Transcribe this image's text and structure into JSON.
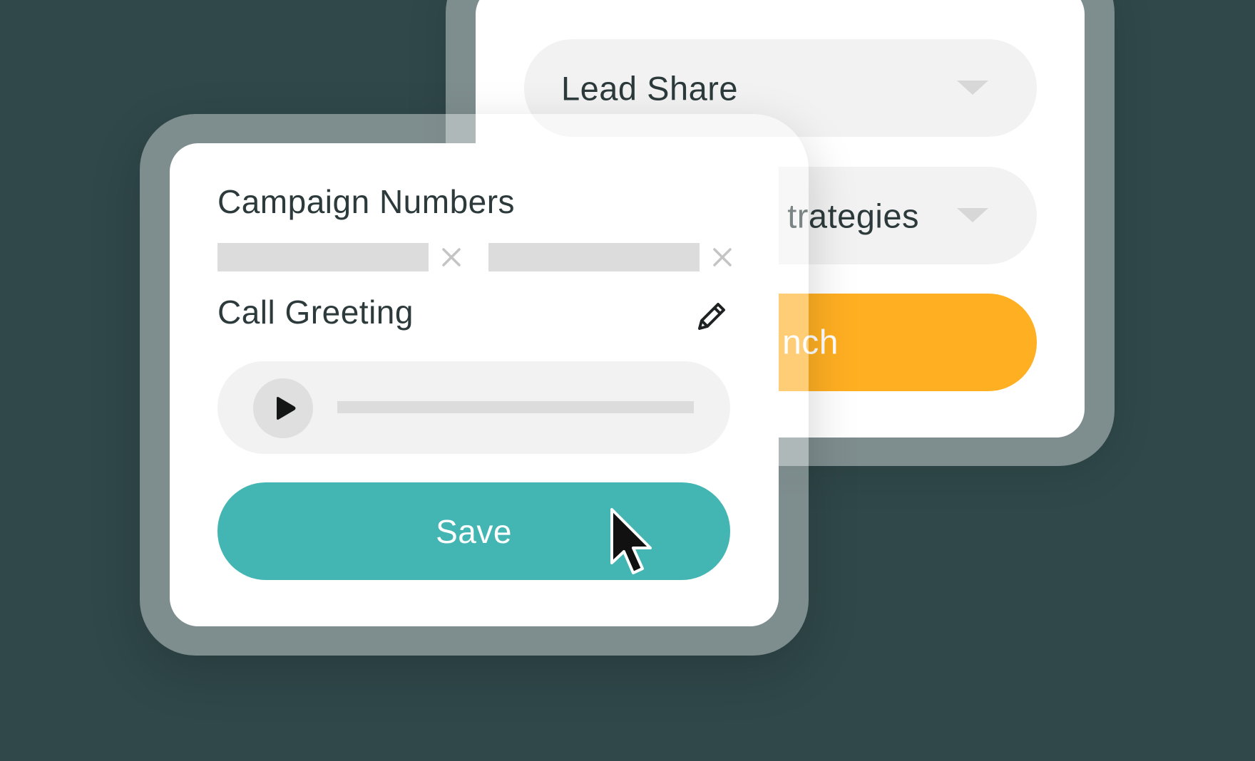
{
  "back_card": {
    "lead_share_select": {
      "label": "Lead Share"
    },
    "strategies_select": {
      "label": "trategies"
    },
    "launch_button": {
      "label": "nch"
    }
  },
  "front_card": {
    "campaign_numbers": {
      "title": "Campaign Numbers",
      "chips": [
        {
          "value": "",
          "remove_icon": "close-icon"
        },
        {
          "value": "",
          "remove_icon": "close-icon"
        }
      ]
    },
    "call_greeting": {
      "title": "Call Greeting",
      "edit_icon": "pencil-icon",
      "player": {
        "play_icon": "play-icon"
      }
    },
    "save_button": {
      "label": "Save"
    }
  },
  "icons": {
    "caret": "chevron-down-icon",
    "cursor": "mouse-pointer-icon"
  },
  "colors": {
    "background": "#30484A",
    "card": "#FFFFFF",
    "pill": "#F2F2F2",
    "placeholder": "#DCDCDC",
    "save_button": "#43B6B4",
    "launch_button": "#FFAF22",
    "text": "#2D3A3B"
  }
}
